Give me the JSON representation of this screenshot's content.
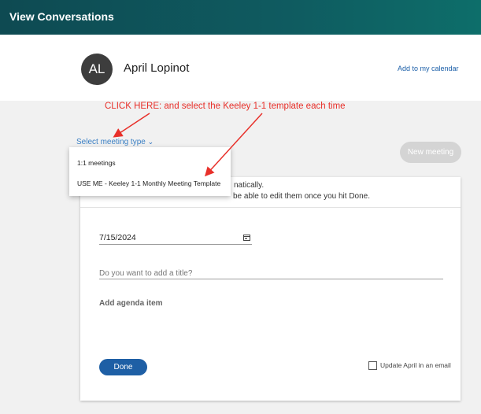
{
  "header": {
    "title": "View Conversations"
  },
  "person": {
    "initials": "AL",
    "name": "April Lopinot"
  },
  "actions": {
    "add_to_calendar": "Add to my calendar",
    "new_meeting": "New meeting"
  },
  "annotation": {
    "text": "CLICK HERE: and select the Keeley 1-1 template each time"
  },
  "meeting_type": {
    "label": "Select meeting type",
    "options": [
      "1:1 meetings",
      "USE ME - Keeley 1-1 Monthly Meeting Template"
    ]
  },
  "notes": {
    "line1": "natically.",
    "line2": "be able to edit them once you hit Done."
  },
  "form": {
    "date": "7/15/2024",
    "title_placeholder": "Do you want to add a title?",
    "agenda_label": "Add agenda item",
    "done_label": "Done",
    "update_label": "Update April in an email"
  },
  "colors": {
    "header_bg": "#0f5b60",
    "annotation": "#e8302a",
    "link": "#1a5ea8",
    "primary_button": "#1e5fa5"
  }
}
